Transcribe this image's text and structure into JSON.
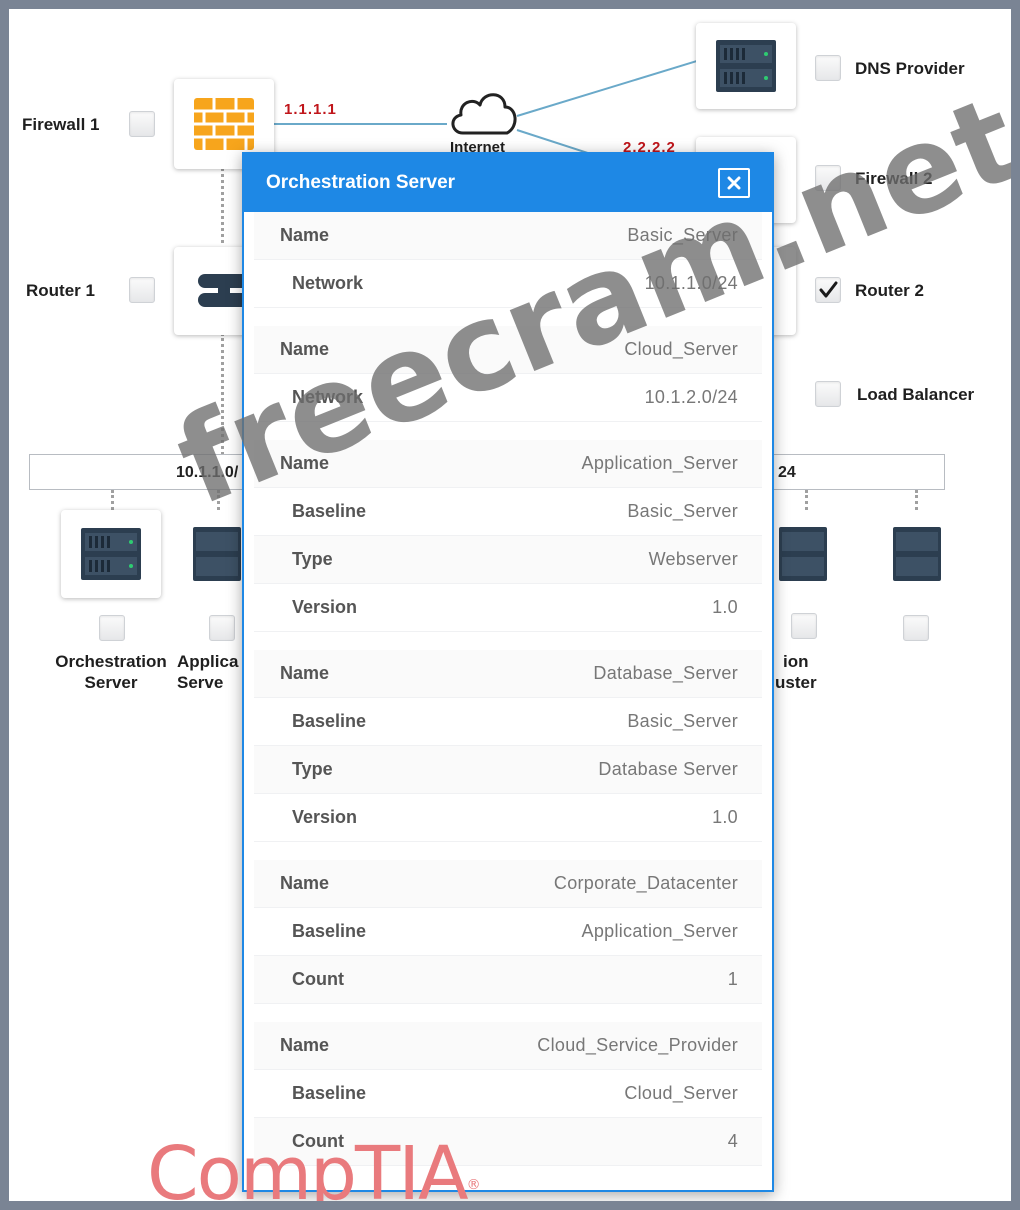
{
  "diagram": {
    "nodes": {
      "firewall1": "Firewall 1",
      "router1": "Router 1",
      "internet": "Internet",
      "dns_provider": "DNS Provider",
      "firewall2": "Firewall 2",
      "router2": "Router 2",
      "load_balancer": "Load Balancer"
    },
    "ips": {
      "firewall1": "1.1.1.1",
      "firewall2": "2.2.2.2"
    },
    "networks": {
      "left": "10.1.1.0/",
      "right": "24"
    },
    "servers": {
      "orchestration_line1": "Orchestration",
      "orchestration_line2": "Server",
      "application_line1": "Applica",
      "application_line2": "Serve",
      "right_partial_line1": "ion",
      "right_partial_line2": "uster"
    },
    "router2_checked": true,
    "link_color": "#6aa9c9"
  },
  "modal": {
    "title": "Orchestration Server",
    "header_color": "#1e88e5",
    "groups": [
      {
        "rows": [
          {
            "key": "Name",
            "value": "Basic_Server"
          },
          {
            "key": "Network",
            "value": "10.1.1.0/24"
          }
        ]
      },
      {
        "rows": [
          {
            "key": "Name",
            "value": "Cloud_Server"
          },
          {
            "key": "Network",
            "value": "10.1.2.0/24"
          }
        ]
      },
      {
        "rows": [
          {
            "key": "Name",
            "value": "Application_Server"
          },
          {
            "key": "Baseline",
            "value": "Basic_Server"
          },
          {
            "key": "Type",
            "value": "Webserver"
          },
          {
            "key": "Version",
            "value": "1.0"
          }
        ]
      },
      {
        "rows": [
          {
            "key": "Name",
            "value": "Database_Server"
          },
          {
            "key": "Baseline",
            "value": "Basic_Server"
          },
          {
            "key": "Type",
            "value": "Database Server"
          },
          {
            "key": "Version",
            "value": "1.0"
          }
        ]
      },
      {
        "rows": [
          {
            "key": "Name",
            "value": "Corporate_Datacenter"
          },
          {
            "key": "Baseline",
            "value": "Application_Server"
          },
          {
            "key": "Count",
            "value": "1"
          }
        ]
      },
      {
        "rows": [
          {
            "key": "Name",
            "value": "Cloud_Service_Provider"
          },
          {
            "key": "Baseline",
            "value": "Cloud_Server"
          },
          {
            "key": "Count",
            "value": "4"
          }
        ]
      }
    ]
  },
  "watermark": "freecram.net",
  "brand": {
    "name": "CompTIA",
    "mark": "®"
  }
}
